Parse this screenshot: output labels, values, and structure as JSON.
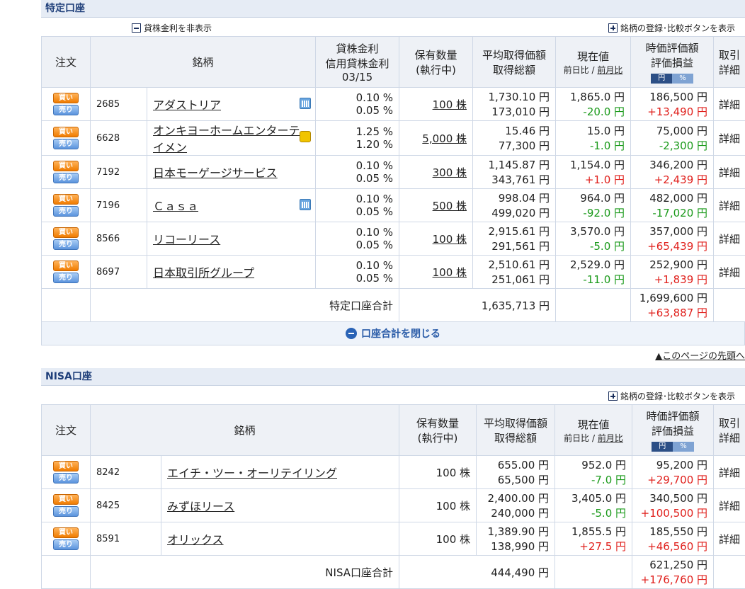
{
  "tokutei": {
    "title": "特定口座",
    "hide_rate_label": "貸株金利を非表示",
    "compare_label": "銘柄の登録･比較ボタンを表示",
    "headers": {
      "order": "注文",
      "name": "銘柄",
      "rate1": "貸株金利",
      "rate2": "信用貸株金利",
      "rate_date": "03/15",
      "qty1": "保有数量",
      "qty2": "(執行中)",
      "avg1": "平均取得価額",
      "avg2": "取得総額",
      "price1": "現在値",
      "price2a": "前日比 / ",
      "price2b": "前月比",
      "val1": "時価評価額",
      "val2": "評価損益",
      "toggle_yen": "円",
      "toggle_pct": "%",
      "trade1": "取引",
      "trade2": "詳細"
    },
    "rows": [
      {
        "buy": "買い",
        "sell": "売り",
        "code": "2685",
        "name": "アダストリア",
        "rate1": "0.10 %",
        "rate2": "0.05 %",
        "qty": "100 株",
        "avg": "1,730.10 円",
        "total": "173,010 円",
        "price": "1,865.0 円",
        "diff": "-20.0 円",
        "value": "186,500 円",
        "pl": "+13,490 円",
        "detail": "詳細"
      },
      {
        "buy": "買い",
        "sell": "売り",
        "code": "6628",
        "name": "オンキヨーホームエンターテイメン",
        "rate1": "1.25 %",
        "rate2": "1.20 %",
        "qty": "5,000 株",
        "avg": "15.46 円",
        "total": "77,300 円",
        "price": "15.0 円",
        "diff": "-1.0 円",
        "value": "75,000 円",
        "pl": "-2,300 円",
        "detail": "詳細"
      },
      {
        "buy": "買い",
        "sell": "売り",
        "code": "7192",
        "name": "日本モーゲージサービス",
        "rate1": "0.10 %",
        "rate2": "0.05 %",
        "qty": "300 株",
        "avg": "1,145.87 円",
        "total": "343,761 円",
        "price": "1,154.0 円",
        "diff": "+1.0 円",
        "value": "346,200 円",
        "pl": "+2,439 円",
        "detail": "詳細"
      },
      {
        "buy": "買い",
        "sell": "売り",
        "code": "7196",
        "name": "Ｃａｓａ",
        "rate1": "0.10 %",
        "rate2": "0.05 %",
        "qty": "500 株",
        "avg": "998.04 円",
        "total": "499,020 円",
        "price": "964.0 円",
        "diff": "-92.0 円",
        "value": "482,000 円",
        "pl": "-17,020 円",
        "detail": "詳細"
      },
      {
        "buy": "買い",
        "sell": "売り",
        "code": "8566",
        "name": "リコーリース",
        "rate1": "0.10 %",
        "rate2": "0.05 %",
        "qty": "100 株",
        "avg": "2,915.61 円",
        "total": "291,561 円",
        "price": "3,570.0 円",
        "diff": "-5.0 円",
        "value": "357,000 円",
        "pl": "+65,439 円",
        "detail": "詳細"
      },
      {
        "buy": "買い",
        "sell": "売り",
        "code": "8697",
        "name": "日本取引所グループ",
        "rate1": "0.10 %",
        "rate2": "0.05 %",
        "qty": "100 株",
        "avg": "2,510.61 円",
        "total": "251,061 円",
        "price": "2,529.0 円",
        "diff": "-11.0 円",
        "value": "252,900 円",
        "pl": "+1,839 円",
        "detail": "詳細"
      }
    ],
    "total_label": "特定口座合計",
    "total_cost": "1,635,713 円",
    "total_value": "1,699,600 円",
    "total_pl": "+63,887 円",
    "close_label": "口座合計を閉じる"
  },
  "to_top": "▲このページの先頭へ",
  "nisa": {
    "title": "NISA口座",
    "compare_label": "銘柄の登録･比較ボタンを表示",
    "headers": {
      "order": "注文",
      "name": "銘柄",
      "qty1": "保有数量",
      "qty2": "(執行中)",
      "avg1": "平均取得価額",
      "avg2": "取得総額",
      "price1": "現在値",
      "price2a": "前日比 / ",
      "price2b": "前月比",
      "val1": "時価評価額",
      "val2": "評価損益",
      "toggle_yen": "円",
      "toggle_pct": "%",
      "trade1": "取引",
      "trade2": "詳細"
    },
    "rows": [
      {
        "buy": "買い",
        "sell": "売り",
        "code": "8242",
        "name": "エイチ・ツー・オーリテイリング",
        "qty": "100 株",
        "avg": "655.00 円",
        "total": "65,500 円",
        "price": "952.0 円",
        "diff": "-7.0 円",
        "value": "95,200 円",
        "pl": "+29,700 円",
        "detail": "詳細"
      },
      {
        "buy": "買い",
        "sell": "売り",
        "code": "8425",
        "name": "みずほリース",
        "qty": "100 株",
        "avg": "2,400.00 円",
        "total": "240,000 円",
        "price": "3,405.0 円",
        "diff": "-5.0 円",
        "value": "340,500 円",
        "pl": "+100,500 円",
        "detail": "詳細"
      },
      {
        "buy": "買い",
        "sell": "売り",
        "code": "8591",
        "name": "オリックス",
        "qty": "100 株",
        "avg": "1,389.90 円",
        "total": "138,990 円",
        "price": "1,855.5 円",
        "diff": "+27.5 円",
        "value": "185,550 円",
        "pl": "+46,560 円",
        "detail": "詳細"
      }
    ],
    "total_label": "NISA口座合計",
    "total_cost": "444,490 円",
    "total_value": "621,250 円",
    "total_pl": "+176,760 円"
  },
  "colors": {
    "positive": "#e0201c",
    "negative": "#1b9a1b",
    "header_bg": "#e6ecf5",
    "accent": "#2a5ca8"
  }
}
